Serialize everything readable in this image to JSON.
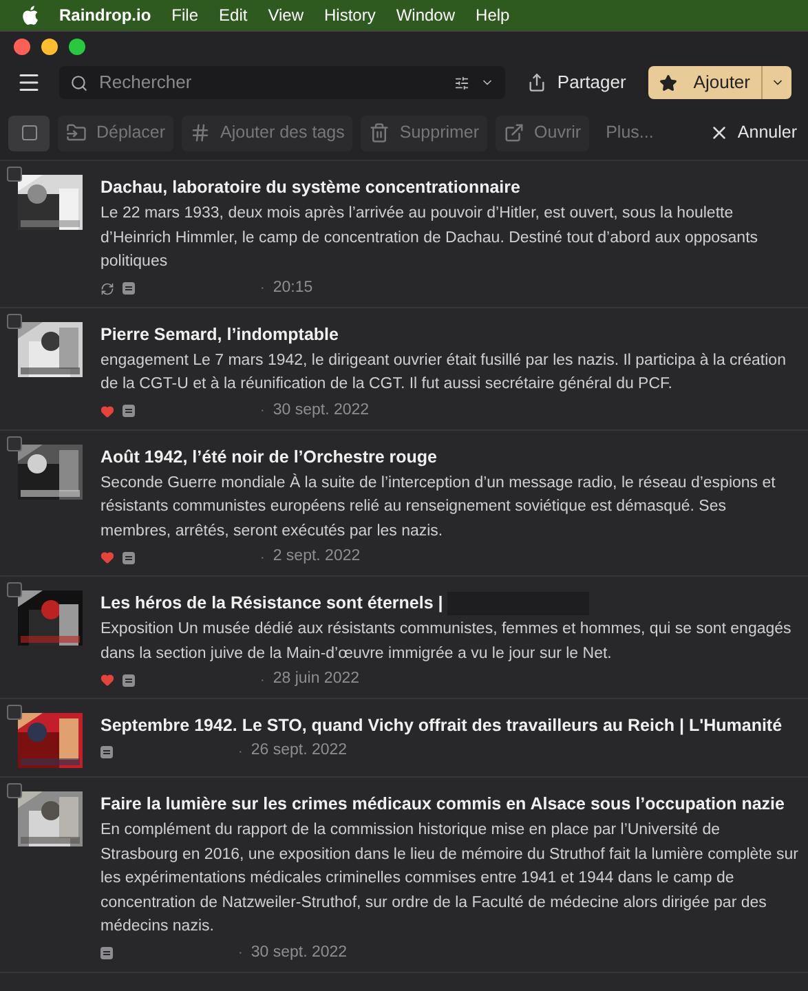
{
  "menu_bar": {
    "app": "Raindrop.io",
    "items": [
      "File",
      "Edit",
      "View",
      "History",
      "Window",
      "Help"
    ]
  },
  "toolbar": {
    "search": {
      "placeholder": "Rechercher"
    },
    "share": "Partager",
    "add": "Ajouter"
  },
  "action_bar": {
    "select_all": {
      "checked": false
    },
    "actions": [
      {
        "kind": "move",
        "label": "Déplacer",
        "disabled": true
      },
      {
        "kind": "tag",
        "label": "Ajouter des tags",
        "disabled": true
      },
      {
        "kind": "delete",
        "label": "Supprimer",
        "disabled": true
      },
      {
        "kind": "open",
        "label": "Ouvrir",
        "disabled": true
      },
      {
        "kind": "more",
        "label": "Plus...",
        "disabled": true
      }
    ],
    "cancel": "Annuler"
  },
  "bookmarks": [
    {
      "title": "Dachau, laboratoire du système concentrationnaire",
      "excerpt": "Le 22 mars 1933, deux mois après l’arrivée au pouvoir d’Hitler, est ouvert, sous la houlette d’Heinrich Himmler, le camp de concentration de Dachau. Destiné tout d’abord aux opposants politiques",
      "syncing": true,
      "favorite": false,
      "checked": false,
      "separator": "·",
      "date": "20:15"
    },
    {
      "title": "Pierre Semard, l’indomptable",
      "excerpt": "engagement Le 7 mars 1942, le dirigeant ouvrier était fusillé par les nazis. Il participa à la création de la CGT-U et à la réunification de la CGT. Il fut aussi secrétaire général du PCF.",
      "syncing": false,
      "favorite": true,
      "checked": false,
      "separator": "·",
      "date": "30 sept. 2022"
    },
    {
      "title": "Août 1942, l’été noir de l’Orchestre rouge",
      "excerpt": "Seconde Guerre mondiale À la suite de l’interception d’un message radio, le réseau d’espions et résistants communistes européens relié au renseignement soviétique est démasqué. Ses membres, arrêtés, seront exécutés par les nazis.",
      "syncing": false,
      "favorite": true,
      "checked": false,
      "separator": "·",
      "date": "2 sept. 2022"
    },
    {
      "title": "Les héros de la Résistance sont éternels |",
      "redacted": true,
      "excerpt": "Exposition Un musée dédié aux résistants communistes, femmes et hommes, qui se sont engagés dans la section juive de la Main-d’œuvre immigrée a vu le jour sur le Net.",
      "syncing": false,
      "favorite": true,
      "checked": false,
      "separator": "·",
      "date": "28 juin 2022"
    },
    {
      "title": "Septembre 1942. Le STO, quand Vichy offrait des travailleurs au Reich | L'Humanité",
      "syncing": false,
      "favorite": false,
      "checked": false,
      "separator": "·",
      "date": "26 sept. 2022"
    },
    {
      "title": "Faire la lumière sur les crimes médicaux commis en Alsace sous l’occupation nazie",
      "excerpt": "En complément du rapport de la commission historique mise en place par l’Université de Strasbourg en 2016, une exposition dans le lieu de mémoire du Struthof fait la lumière complète sur les expérimentations médicales criminelles commises entre 1941 et 1944 dans le camp de concentration de Natzweiler-Struthof, sur ordre de la Faculté de médecine alors dirigée par des médecins nazis.",
      "syncing": false,
      "favorite": false,
      "checked": false,
      "separator": "·",
      "date": "30 sept. 2022"
    }
  ]
}
